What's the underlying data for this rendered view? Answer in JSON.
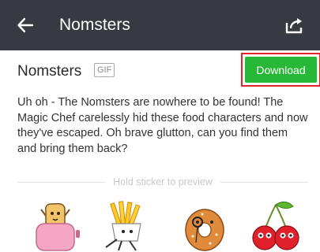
{
  "header": {
    "title": "Nomsters",
    "back_icon": "back-arrow-icon",
    "share_icon": "share-icon",
    "background": "#383a41"
  },
  "pack": {
    "title": "Nomsters",
    "badge": "GIF",
    "download_label": "Download",
    "description": "Uh oh - The Nomsters are nowhere to be found! The Magic Chef carelessly hid these food characters and now they've escaped. Oh brave glutton, can you find them and bring them back?"
  },
  "preview": {
    "hint": "Hold sticker to preview",
    "stickers": [
      "toaster-sticker",
      "fries-sticker",
      "bagel-sticker",
      "cherries-sticker"
    ]
  },
  "colors": {
    "download_green": "#28b837",
    "highlight_red": "#e1232a"
  }
}
